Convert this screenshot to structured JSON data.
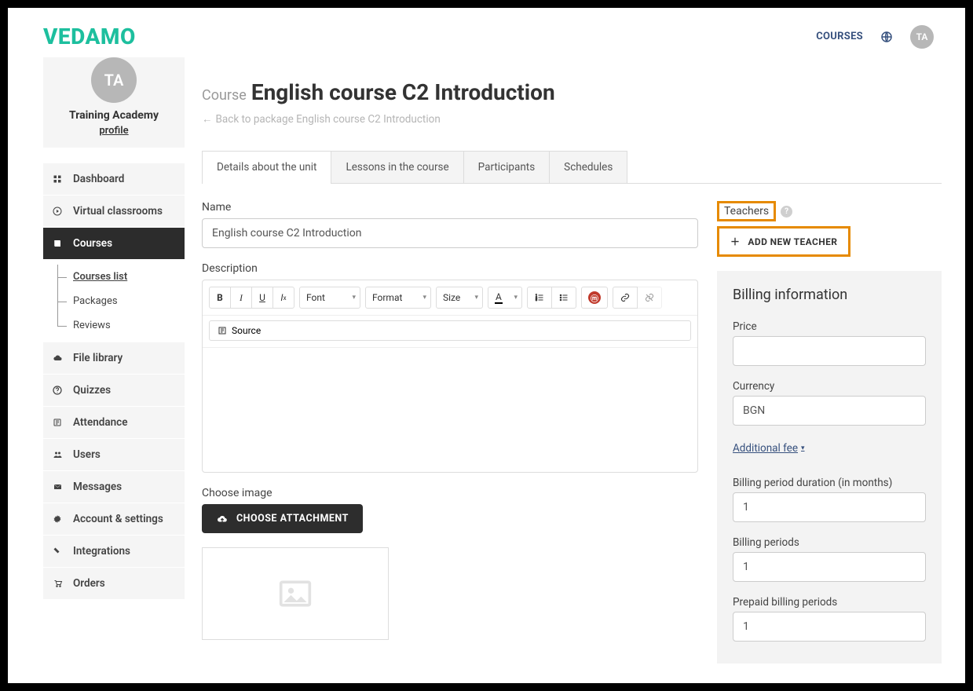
{
  "header": {
    "brand": "VEDAMO",
    "link_courses": "COURSES",
    "avatar_initials": "TA"
  },
  "profile": {
    "avatar_initials": "TA",
    "org_name": "Training Academy",
    "profile_link": "profile"
  },
  "nav": {
    "dashboard": "Dashboard",
    "virtual_classrooms": "Virtual classrooms",
    "courses": "Courses",
    "courses_sub": {
      "courses_list": "Courses list",
      "packages": "Packages",
      "reviews": "Reviews"
    },
    "file_library": "File library",
    "quizzes": "Quizzes",
    "attendance": "Attendance",
    "users": "Users",
    "messages": "Messages",
    "account_settings": "Account & settings",
    "integrations": "Integrations",
    "orders": "Orders"
  },
  "page": {
    "title_prefix": "Course",
    "title": "English course C2 Introduction",
    "back_link": "Back to package English course C2 Introduction"
  },
  "tabs": {
    "details": "Details about the unit",
    "lessons": "Lessons in the course",
    "participants": "Participants",
    "schedules": "Schedules"
  },
  "form": {
    "name_label": "Name",
    "name_value": "English course C2 Introduction",
    "description_label": "Description",
    "choose_image_label": "Choose image",
    "choose_attachment_btn": "CHOOSE ATTACHMENT"
  },
  "editor": {
    "font_label": "Font",
    "format_label": "Format",
    "size_label": "Size",
    "source_label": "Source"
  },
  "teachers": {
    "label": "Teachers",
    "add_btn": "ADD NEW TEACHER"
  },
  "billing": {
    "heading": "Billing information",
    "price_label": "Price",
    "price_value": "",
    "currency_label": "Currency",
    "currency_value": "BGN",
    "additional_fee": "Additional fee",
    "duration_label": "Billing period duration (in months)",
    "duration_value": "1",
    "periods_label": "Billing periods",
    "periods_value": "1",
    "prepaid_label": "Prepaid billing periods",
    "prepaid_value": "1"
  }
}
